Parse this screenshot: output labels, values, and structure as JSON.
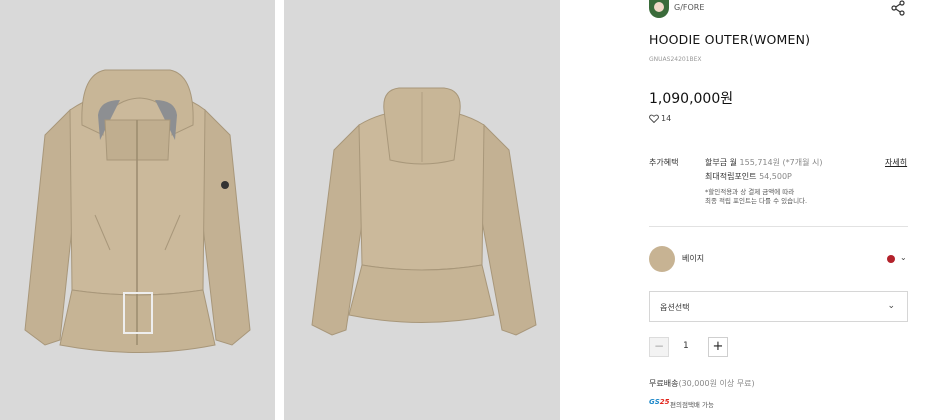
{
  "images": {
    "front_alt": "",
    "back_alt": ""
  },
  "brand": {
    "name": "G/FORE",
    "avatar_icon": "brand-avatar"
  },
  "product": {
    "title": "HOODIE OUTER(WOMEN)",
    "code": "GNUAS24201BEX",
    "price": "1,090,000원",
    "likes": "14"
  },
  "benefits": {
    "label": "추가혜택",
    "installment_prefix": "할부금 월 ",
    "installment_amount": "155,714원",
    "installment_suffix": " (*7개월 시)",
    "points_label": "최대적립포인트 ",
    "points_value": "54,500P",
    "note_line1": "*할인적용과 상 결제 금액에 따라",
    "note_line2": "최종 적립 포인트는 다를 수 있습니다.",
    "details_link": "자세히"
  },
  "color": {
    "name": "베이지",
    "swatch": "#c7b393",
    "indicator": "#b3222b"
  },
  "option": {
    "label": "옵션선택"
  },
  "quantity": {
    "minus": "−",
    "value": "1",
    "plus": "+"
  },
  "shipping": {
    "main": "무료배송",
    "detail": "(30,000원 이상 무료)",
    "gs25_gs": "GS",
    "gs25_num": "25",
    "gs25_text": "편의점택배 가능"
  }
}
